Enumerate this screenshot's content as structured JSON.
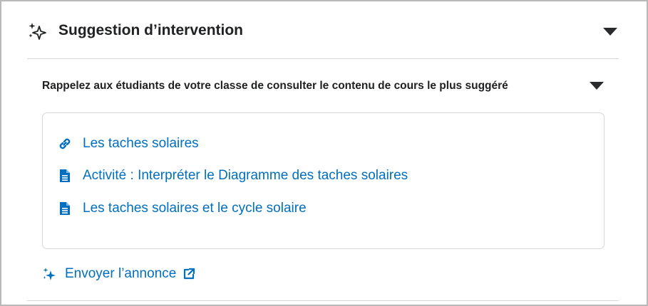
{
  "panel": {
    "title": "Suggestion d’intervention",
    "icon": "sparkle-icon",
    "collapse_icon": "chevron-down-icon"
  },
  "suggestion": {
    "title": "Rappelez aux étudiants de votre classe de consulter le contenu de cours le plus suggéré",
    "collapse_icon": "chevron-down-icon"
  },
  "content_items": [
    {
      "label": "Les taches solaires",
      "icon": "link-icon"
    },
    {
      "label": "Activité : Interpréter le Diagramme des taches solaires",
      "icon": "document-icon"
    },
    {
      "label": "Les taches solaires et le cycle solaire",
      "icon": "document-icon"
    }
  ],
  "action": {
    "label": "Envoyer l’annonce",
    "icon": "sparkle-icon",
    "external_icon": "external-link-icon"
  },
  "colors": {
    "link": "#006fbf",
    "text": "#202122",
    "border": "#d6d7da",
    "chevron": "#2a2b2d"
  }
}
